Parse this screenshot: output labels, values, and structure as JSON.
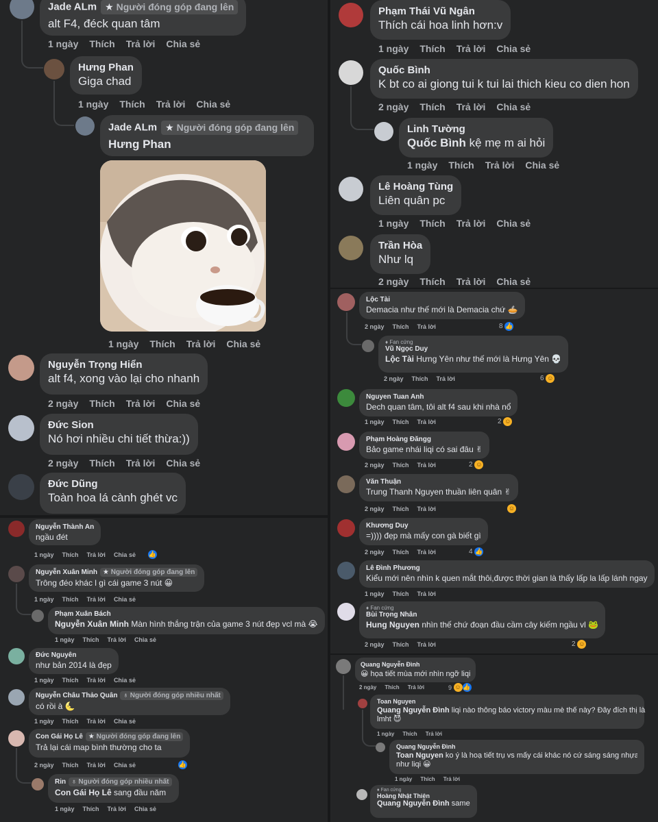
{
  "panel_tl": {
    "c1": {
      "name": "Jade ALm",
      "badge": "Người đóng góp đang lên",
      "text": "alt F4, đéck quan tâm",
      "time": "1 ngày",
      "like": "Thích",
      "reply": "Trả lời",
      "share": "Chia sẻ"
    },
    "c2": {
      "name": "Hưng Phan",
      "text": "Giga chad",
      "time": "1 ngày",
      "like": "Thích",
      "reply": "Trả lời",
      "share": "Chia sẻ"
    },
    "c3": {
      "name": "Jade ALm",
      "badge": "Người đóng góp đang lên",
      "text": "Hưng Phan",
      "time": "1 ngày",
      "like": "Thích",
      "reply": "Trả lời",
      "share": "Chia sẻ"
    },
    "c4": {
      "name": "Nguyễn Trọng Hiển",
      "text": "alt f4, xong vào lại cho nhanh",
      "time": "2 ngày",
      "like": "Thích",
      "reply": "Trả lời",
      "share": "Chia sẻ"
    },
    "c5": {
      "name": "Đức Sion",
      "text": "Nó hơi nhiều chi tiết thừa:))",
      "time": "2 ngày",
      "like": "Thích",
      "reply": "Trả lời",
      "share": "Chia sẻ"
    },
    "c6": {
      "name": "Đức Dũng",
      "text": "Toàn hoa lá cành ghét vc"
    }
  },
  "panel_tr": {
    "c1": {
      "name": "Phạm Thái Vũ Ngân",
      "text": "Thích cái hoa linh hơn:v",
      "time": "1 ngày",
      "like": "Thích",
      "reply": "Trả lời",
      "share": "Chia sẻ"
    },
    "c2": {
      "name": "Quốc Bình",
      "text": "K bt co ai giong tui k tui lai thich kieu co dien hon",
      "time": "2 ngày",
      "like": "Thích",
      "reply": "Trả lời",
      "share": "Chia sẻ"
    },
    "c3": {
      "name": "Linh Tường",
      "mention": "Quốc Bình",
      "text": " kệ mẹ m ai hỏi",
      "time": "1 ngày",
      "like": "Thích",
      "reply": "Trả lời",
      "share": "Chia sẻ"
    },
    "c4": {
      "name": "Lê Hoàng Tùng",
      "text": "Liên quân pc",
      "time": "1 ngày",
      "like": "Thích",
      "reply": "Trả lời",
      "share": "Chia sẻ"
    },
    "c5": {
      "name": "Trần Hòa",
      "text": "Như lq",
      "time": "2 ngày",
      "like": "Thích",
      "reply": "Trả lời",
      "share": "Chia sẻ"
    }
  },
  "panel_bl": {
    "c1": {
      "name": "Nguyễn Thành An",
      "text": "ngầu đét",
      "time": "1 ngày",
      "like": "Thích",
      "reply": "Trả lời",
      "share": "Chia sẻ"
    },
    "c2": {
      "name": "Nguyễn Xuân Minh",
      "badge": "Người đóng góp đang lên",
      "text": "Trông đéo khác l gì cái game 3 nút 😀",
      "time": "1 ngày",
      "like": "Thích",
      "reply": "Trả lời",
      "share": "Chia sẻ"
    },
    "c3": {
      "name": "Phạm Xuân Bách",
      "mention": "Nguyễn Xuân Minh",
      "text": " Màn hình thắng trận của game 3 nút đẹp vcl mà 😭",
      "time": "1 ngày",
      "like": "Thích",
      "reply": "Trả lời",
      "share": "Chia sẻ"
    },
    "c4": {
      "name": "Đức Nguyên",
      "text": "như bản 2014 là đẹp",
      "time": "1 ngày",
      "like": "Thích",
      "reply": "Trả lời",
      "share": "Chia sẻ"
    },
    "c5": {
      "name": "Nguyễn Châu Thảo Quân",
      "badge": "Người đóng góp nhiều nhất",
      "text": "có rồi à 🌜",
      "time": "1 ngày",
      "like": "Thích",
      "reply": "Trả lời",
      "share": "Chia sẻ"
    },
    "c6": {
      "name": "Con Gái Họ Lê",
      "badge": "Người đóng góp đang lên",
      "text": "Trả lại cái map bình thường cho ta",
      "time": "2 ngày",
      "like": "Thích",
      "reply": "Trả lời",
      "share": "Chia sẻ"
    },
    "c7": {
      "name": "Rin",
      "badge": "Người đóng góp nhiều nhất",
      "mention": "Con Gái Họ Lê",
      "text": " sang đầu năm",
      "time": "1 ngày",
      "like": "Thích",
      "reply": "Trả lời",
      "share": "Chia sẻ"
    }
  },
  "panel_mr": {
    "c1": {
      "name": "Lộc Tài",
      "text": "Demacia như thế mới là Demacia chứ 🥧",
      "time": "2 ngày",
      "like": "Thích",
      "reply": "Trả lời",
      "count": "8"
    },
    "c2": {
      "fan": "Fan cứng",
      "name": "Vũ Ngọc Duy",
      "mention": "Lộc Tài",
      "text": " Hưng Yên như thế mới là Hưng Yên 💀",
      "time": "2 ngày",
      "like": "Thích",
      "reply": "Trả lời",
      "count": "6"
    },
    "c3": {
      "name": "Nguyen Tuan Anh",
      "text": "Dech quan tâm, tôi alt f4 sau khi nhà nổ",
      "time": "1 ngày",
      "like": "Thích",
      "reply": "Trả lời",
      "count": "2"
    },
    "c4": {
      "name": "Phạm Hoàng Đăngg",
      "text": "Bảo game nhái liqi có sai đâu ✌",
      "time": "2 ngày",
      "like": "Thích",
      "reply": "Trả lời",
      "count": "2"
    },
    "c5": {
      "name": "Văn Thuận",
      "text": "Trung Thanh Nguyen thuần liên quân ✌",
      "time": "2 ngày",
      "like": "Thích",
      "reply": "Trả lời"
    },
    "c6": {
      "name": "Khương Duy",
      "text": "=)))) đẹp mà mấy con gà biết gì",
      "time": "2 ngày",
      "like": "Thích",
      "reply": "Trả lời",
      "count": "4"
    },
    "c7": {
      "name": "Lê Đình Phương",
      "text": "Kiểu mới nên nhìn k quen mắt thôi,được thời gian là thấy lấp la lấp lánh ngay",
      "time": "1 ngày",
      "like": "Thích",
      "reply": "Trả lời"
    },
    "c8": {
      "fan": "Fan cứng",
      "name": "Bùi Trọng Nhân",
      "mention": "Hung Nguyen",
      "text": " nhìn thế chứ đoạn đầu cầm cây kiếm ngầu vl 🐸",
      "time": "2 ngày",
      "like": "Thích",
      "reply": "Trả lời",
      "count": "2"
    }
  },
  "panel_br": {
    "c1": {
      "name": "Quang Nguyễn Đình",
      "text": "😀 họa tiết mùa mới nhìn ngỡ liqi",
      "time": "2 ngày",
      "like": "Thích",
      "reply": "Trả lời",
      "count": "9"
    },
    "c2": {
      "name": "Toan Nguyen",
      "mention": "Quang Nguyễn Đình",
      "text": " liqi nào thông báo victory màu mè thế này? Đây đích thị là",
      "text2": "lmht 😈",
      "time": "1 ngày",
      "like": "Thích",
      "reply": "Trả lời"
    },
    "c3": {
      "name": "Quang Nguyễn Đình",
      "mention": "Toan Nguyen",
      "text": " ko ý là hoạ tiết trụ vs mấy cái khác nó cứ sáng sáng nhựa nhựa",
      "text2": "như liqi 😀",
      "time": "1 ngày",
      "like": "Thích",
      "reply": "Trả lời"
    },
    "c4": {
      "fan": "Fan cứng",
      "name": "Hoàng Nhật Thiên",
      "mention": "Quang Nguyễn Đình",
      "text": " same",
      "time": "2 ngày",
      "like": "Thích",
      "reply": "Trả lời"
    }
  },
  "colors": {
    "bg": "#18191a",
    "panel": "#242526",
    "bubble": "#3a3b3c",
    "text": "#e4e6eb",
    "meta": "#b0b3b8",
    "like": "#1877f2"
  },
  "icons": [
    "star-icon",
    "like-reaction-icon",
    "haha-reaction-icon",
    "avatar-icon"
  ]
}
